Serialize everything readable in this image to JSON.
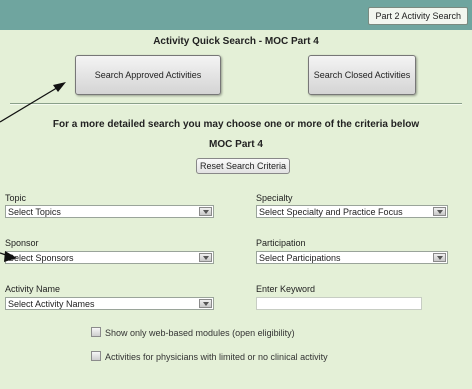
{
  "header": {
    "tab_label": "Part 2 Activity Search"
  },
  "quick_search": {
    "title": "Activity Quick Search - MOC Part 4",
    "approved_button": "Search Approved Activities",
    "closed_button": "Search Closed Activities"
  },
  "detailed": {
    "intro": "For a more detailed search you may choose one or more of the criteria below",
    "subtitle": "MOC Part 4",
    "reset_button": "Reset Search Criteria"
  },
  "criteria": {
    "topic": {
      "label": "Topic",
      "value": "Select Topics"
    },
    "specialty": {
      "label": "Specialty",
      "value": "Select Specialty and Practice Focus"
    },
    "sponsor": {
      "label": "Sponsor",
      "value": "Select Sponsors"
    },
    "participation": {
      "label": "Participation",
      "value": "Select Participations"
    },
    "activity_name": {
      "label": "Activity Name",
      "value": "Select Activity Names"
    },
    "keyword": {
      "label": "Enter Keyword",
      "value": ""
    }
  },
  "options": {
    "web_based": "Show only web-based modules (open eligibility)",
    "limited_clinical": "Activities for physicians with limited or no clinical activity"
  }
}
